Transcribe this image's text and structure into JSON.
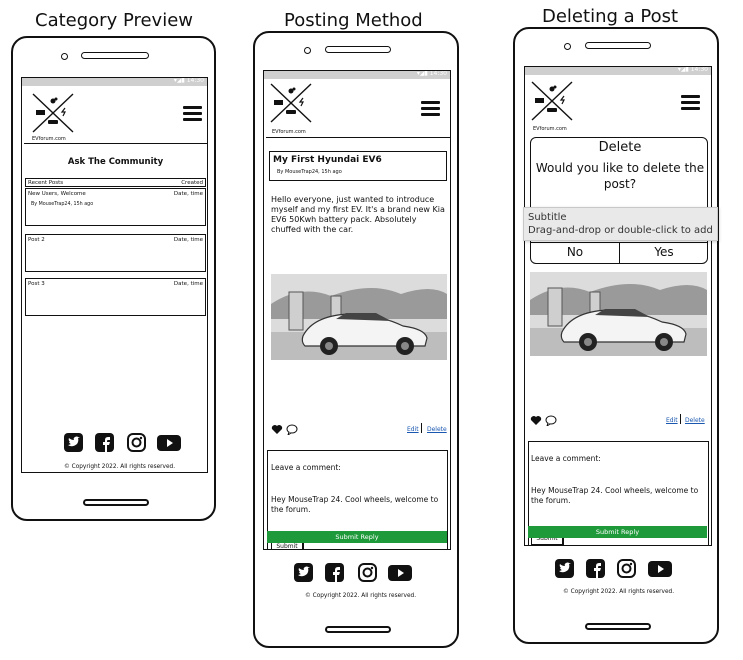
{
  "headings": {
    "left": "Category Preview",
    "middle": "Posting Method",
    "right": "Deleting a Post"
  },
  "brand": {
    "logo_text": "EVforum.com"
  },
  "category": {
    "title": "Ask The Community",
    "header_left": "Recent Posts",
    "header_right": "Created",
    "posts": [
      {
        "title": "New Users, Welcome",
        "date": "Date, time",
        "author": "By MouseTrap24, 15h ago"
      },
      {
        "title": "Post 2",
        "date": "Date, time"
      },
      {
        "title": "Post 3",
        "date": "Date, time"
      }
    ],
    "copyright": "Copyright 2022. All rights reserved."
  },
  "post": {
    "title": "My First Hyundai EV6",
    "author": "By MouseTrap24, 15h ago",
    "body": "Hello everyone, just wanted to introduce myself and my first EV. It's a brand new Kia EV6 50Kwh battery pack. Absolutely chuffed with the car.",
    "edit_label": "Edit",
    "delete_label": "Delete",
    "comment_prompt": "Leave a comment:",
    "comment_text": "Hey MouseTrap 24. Cool wheels, welcome to the forum.",
    "submit_label": "Submit",
    "submit_reply_label": "Submit Reply",
    "copyright": "Copyright 2022. All rights reserved."
  },
  "delete": {
    "dialog_title": "Delete",
    "dialog_question": "Would you like to delete the post?",
    "no_label": "No",
    "yes_label": "Yes",
    "edit_label": "Edit",
    "delete_label": "Delete",
    "comment_prompt": "Leave a comment:",
    "comment_text": "Hey MouseTrap 24. Cool wheels, welcome to the forum.",
    "submit_label": "Submit",
    "submit_reply_label": "Submit Reply",
    "copyright": "Copyright 2022. All rights reserved."
  },
  "tooltip": {
    "title": "Subtitle",
    "hint": "Drag-and-drop or double-click to add"
  },
  "colors": {
    "accent_green": "#1f9a3a",
    "link_blue": "#1a57b0",
    "status_bar": "#cfcfcf"
  }
}
